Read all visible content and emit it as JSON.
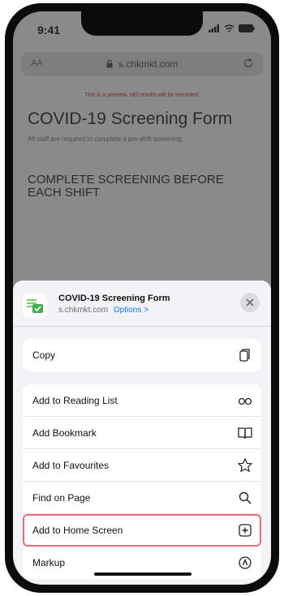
{
  "status_bar": {
    "time": "9:41"
  },
  "browser": {
    "text_size_button": "AA",
    "url": "s.chkmkt.com"
  },
  "page": {
    "preview_note": "This is a preview. NO results will be recorded.",
    "title": "COVID-19 Screening Form",
    "subtitle": "All staff are required to complete a pre-shift screening.",
    "heading": "COMPLETE SCREENING BEFORE EACH SHIFT"
  },
  "share_sheet": {
    "title": "COVID-19 Screening Form",
    "domain": "s.chkmkt.com",
    "options_label": "Options >",
    "copy": {
      "label": "Copy",
      "icon": "copy-icon"
    },
    "actions": [
      {
        "label": "Add to Reading List",
        "icon": "glasses-icon"
      },
      {
        "label": "Add Bookmark",
        "icon": "book-icon"
      },
      {
        "label": "Add to Favourites",
        "icon": "star-icon"
      },
      {
        "label": "Find on Page",
        "icon": "search-icon"
      },
      {
        "label": "Add to Home Screen",
        "icon": "plus-square-icon",
        "highlighted": true
      },
      {
        "label": "Markup",
        "icon": "markup-icon"
      }
    ]
  },
  "colors": {
    "accent": "#0a7aff",
    "highlight": "#e46f77",
    "sheet_bg": "#f2f2f7"
  }
}
